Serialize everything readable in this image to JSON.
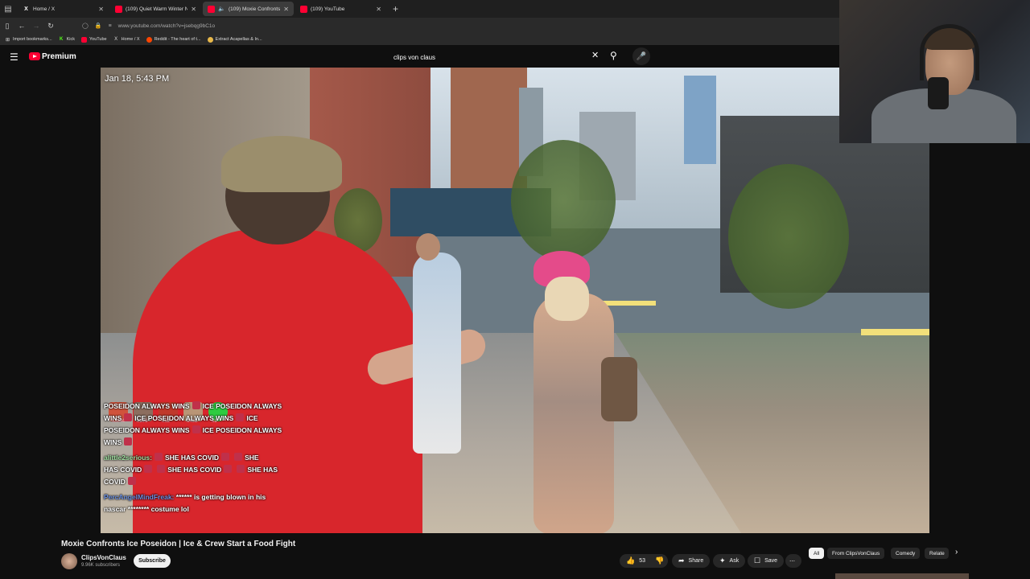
{
  "browser": {
    "tabs": [
      {
        "label": "Home / X",
        "icon": "x-icon",
        "active": false
      },
      {
        "label": "(109) Quiet Warm Winter Night",
        "icon": "youtube-icon",
        "active": false
      },
      {
        "label": "(109) Moxie Confronts Ice P",
        "icon": "youtube-icon",
        "active": true,
        "audio": true
      },
      {
        "label": "(109) YouTube",
        "icon": "youtube-icon",
        "active": false
      }
    ],
    "new_tab": "+",
    "url": "www.youtube.com/watch?v=jsebqg9bC1o",
    "bookmarks": [
      {
        "label": "Import bookmarks...",
        "icon": "import-icon"
      },
      {
        "label": "Kick",
        "icon": "kick-icon"
      },
      {
        "label": "YouTube",
        "icon": "youtube-icon"
      },
      {
        "label": "Home / X",
        "icon": "x-icon"
      },
      {
        "label": "Reddit - The heart of t...",
        "icon": "reddit-icon"
      },
      {
        "label": "Extract Acapellas & In...",
        "icon": "folder-icon"
      }
    ]
  },
  "header": {
    "brand": "Premium",
    "search_query": "clips von claus"
  },
  "video": {
    "timestamp": "Jan 18, 5:43 PM",
    "emote_counts": [
      "x1040",
      "x596",
      "x12",
      "x432",
      "x3"
    ],
    "chat": {
      "line1": "POSEIDON ALWAYS WINS",
      "line1b": "ICE POSEIDON ALWAYS",
      "line2a": "WINS",
      "line2b": "ICE POSEIDON ALWAYS WINS",
      "line2c": "ICE",
      "line3a": "POSEIDON ALWAYS WINS",
      "line3b": "ICE POSEIDON ALWAYS",
      "line4a": "WINS",
      "msg2_user": "alittle2serious:",
      "msg2a": "SHE HAS COVID",
      "msg2b": "SHE",
      "msg2c": "HAS COVID",
      "msg2d": "SHE HAS COVID",
      "msg2e": "SHE HAS",
      "msg2f": "COVID",
      "msg3_user": "PercAngelMindFreak:",
      "msg3a": "****** is getting blown in his",
      "msg3b": "nascar ******** costume lol"
    }
  },
  "details": {
    "title": "Moxie Confronts Ice Poseidon | Ice & Crew Start a Food Fight",
    "channel": "ClipsVonClaus",
    "subscribers": "9.96K subscribers",
    "subscribe_label": "Subscribe",
    "likes": "53",
    "share_label": "Share",
    "ask_label": "Ask",
    "save_label": "Save",
    "more_label": "⋯"
  },
  "chips": [
    {
      "label": "All",
      "active": true
    },
    {
      "label": "From ClipsVonClaus",
      "active": false
    },
    {
      "label": "Comedy",
      "active": false
    },
    {
      "label": "Relate",
      "active": false
    }
  ],
  "colors": {
    "yt_red": "#ff0033",
    "bg": "#0f0f0f",
    "pill": "#272727"
  }
}
